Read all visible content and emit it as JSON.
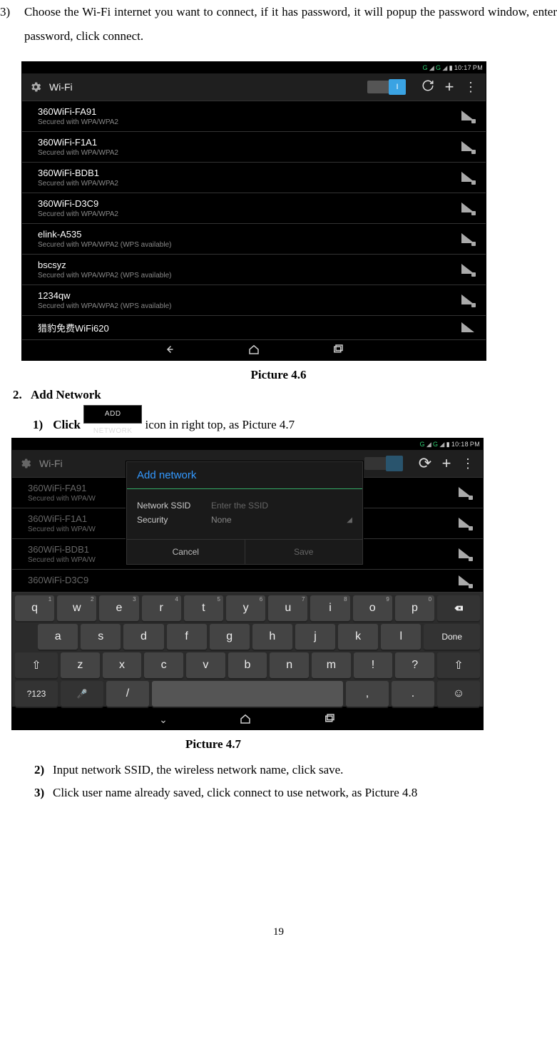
{
  "instruction3": {
    "num": "3)",
    "text": "Choose the Wi-Fi internet you want to connect, if it has password, it will popup the password window, enter password, click connect."
  },
  "screenshot1": {
    "time": "10:17",
    "ampm": "PM",
    "title": "Wi-Fi",
    "toggle": "I",
    "networks": [
      {
        "name": "360WiFi-FA91",
        "sec": "Secured with WPA/WPA2",
        "lock": true
      },
      {
        "name": "360WiFi-F1A1",
        "sec": "Secured with WPA/WPA2",
        "lock": true
      },
      {
        "name": "360WiFi-BDB1",
        "sec": "Secured with WPA/WPA2",
        "lock": true
      },
      {
        "name": "360WiFi-D3C9",
        "sec": "Secured with WPA/WPA2",
        "lock": true
      },
      {
        "name": "elink-A535",
        "sec": "Secured with WPA/WPA2 (WPS available)",
        "lock": true
      },
      {
        "name": "bscsyz",
        "sec": "Secured with WPA/WPA2 (WPS available)",
        "lock": true
      },
      {
        "name": "1234qw",
        "sec": "Secured with WPA/WPA2 (WPS available)",
        "lock": true
      },
      {
        "name": "猎豹免费WiFi620",
        "sec": "",
        "lock": false
      }
    ],
    "caption": "Picture 4.6"
  },
  "section2": {
    "num": "2.",
    "title": "Add Network",
    "step1_num": "1)",
    "step1_a": "Click",
    "step1_chip": "ADD NETWORK",
    "step1_b": "icon in right top, as Picture 4.7"
  },
  "screenshot2": {
    "time": "10:18",
    "ampm": "PM",
    "title": "Wi-Fi",
    "networks": [
      {
        "name": "360WiFi-FA91",
        "sec": "Secured with WPA/W"
      },
      {
        "name": "360WiFi-F1A1",
        "sec": "Secured with WPA/W"
      },
      {
        "name": "360WiFi-BDB1",
        "sec": "Secured with WPA/W"
      },
      {
        "name": "360WiFi-D3C9",
        "sec": ""
      }
    ],
    "dialog": {
      "title": "Add network",
      "ssid_label": "Network SSID",
      "ssid_ph": "Enter the SSID",
      "sec_label": "Security",
      "sec_val": "None",
      "cancel": "Cancel",
      "save": "Save"
    },
    "keyboard": {
      "row1": [
        "q",
        "w",
        "e",
        "r",
        "t",
        "y",
        "u",
        "i",
        "o",
        "p"
      ],
      "row1sup": [
        "1",
        "2",
        "3",
        "4",
        "5",
        "6",
        "7",
        "8",
        "9",
        "0"
      ],
      "row2": [
        "a",
        "s",
        "d",
        "f",
        "g",
        "h",
        "j",
        "k",
        "l"
      ],
      "row2_done": "Done",
      "row3": [
        "z",
        "x",
        "c",
        "v",
        "b",
        "n",
        "m",
        "!",
        "?"
      ],
      "row4_sym": "?123",
      "row4_slash": "/",
      "row4_comma": ",",
      "row4_dot": "."
    },
    "caption": "Picture 4.7"
  },
  "steps23": {
    "s2n": "2)",
    "s2": "Input network SSID, the wireless network name, click save.",
    "s3n": "3)",
    "s3": "Click user name already saved, click connect to use network, as Picture 4.8"
  },
  "pagenum": "19"
}
